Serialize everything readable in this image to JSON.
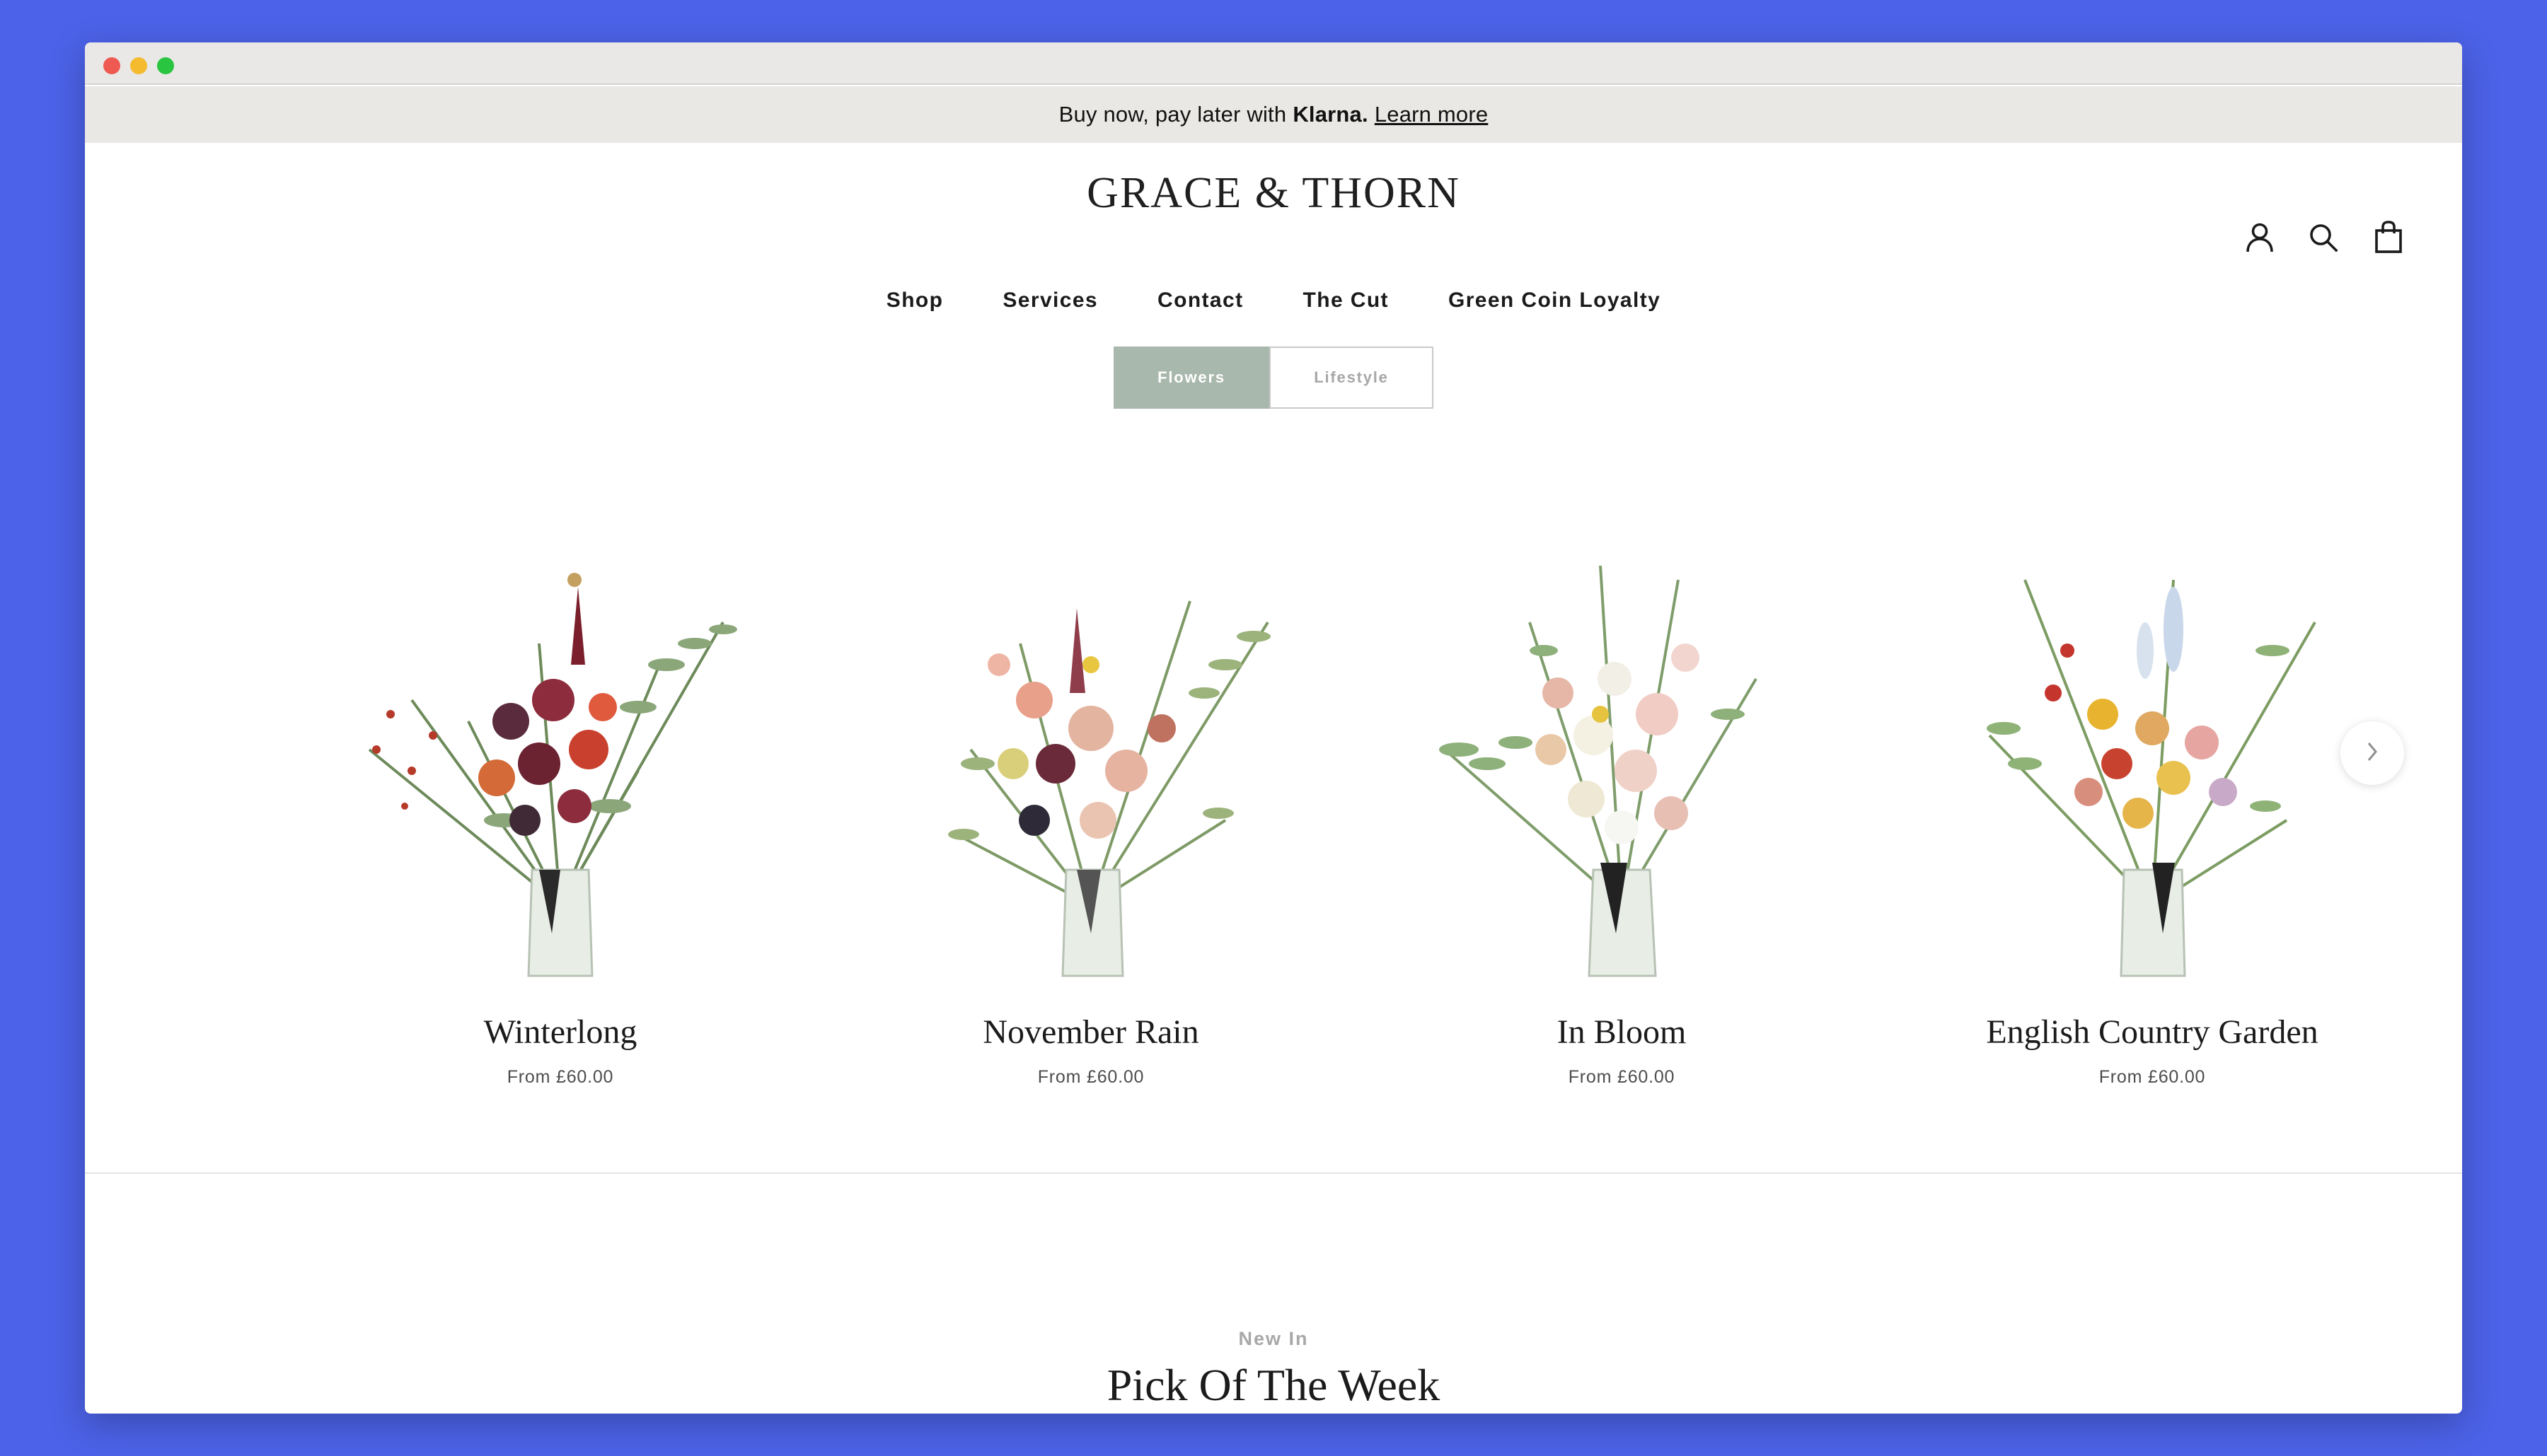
{
  "announcement": {
    "text": "Buy now, pay later with",
    "brand": "Klarna.",
    "link": "Learn more"
  },
  "header": {
    "logo": "GRACE & THORN",
    "icons": [
      "account-icon",
      "search-icon",
      "bag-icon"
    ]
  },
  "nav": {
    "items": [
      "Shop",
      "Services",
      "Contact",
      "The Cut",
      "Green Coin Loyalty"
    ]
  },
  "tabs": {
    "items": [
      {
        "label": "Flowers",
        "active": true
      },
      {
        "label": "Lifestyle",
        "active": false
      }
    ]
  },
  "products": [
    {
      "name": "Winterlong",
      "price": "From £60.00"
    },
    {
      "name": "November Rain",
      "price": "From £60.00"
    },
    {
      "name": "In Bloom",
      "price": "From £60.00"
    },
    {
      "name": "English Country Garden",
      "price": "From £60.00"
    }
  ],
  "carousel": {
    "next_icon": "chevron-right-icon"
  },
  "section": {
    "kicker": "New In",
    "title": "Pick Of The Week"
  },
  "colors": {
    "page_bg": "#4c62e8",
    "tab_active": "#a9b8ad",
    "announcement_bg": "#e9e8e5"
  }
}
